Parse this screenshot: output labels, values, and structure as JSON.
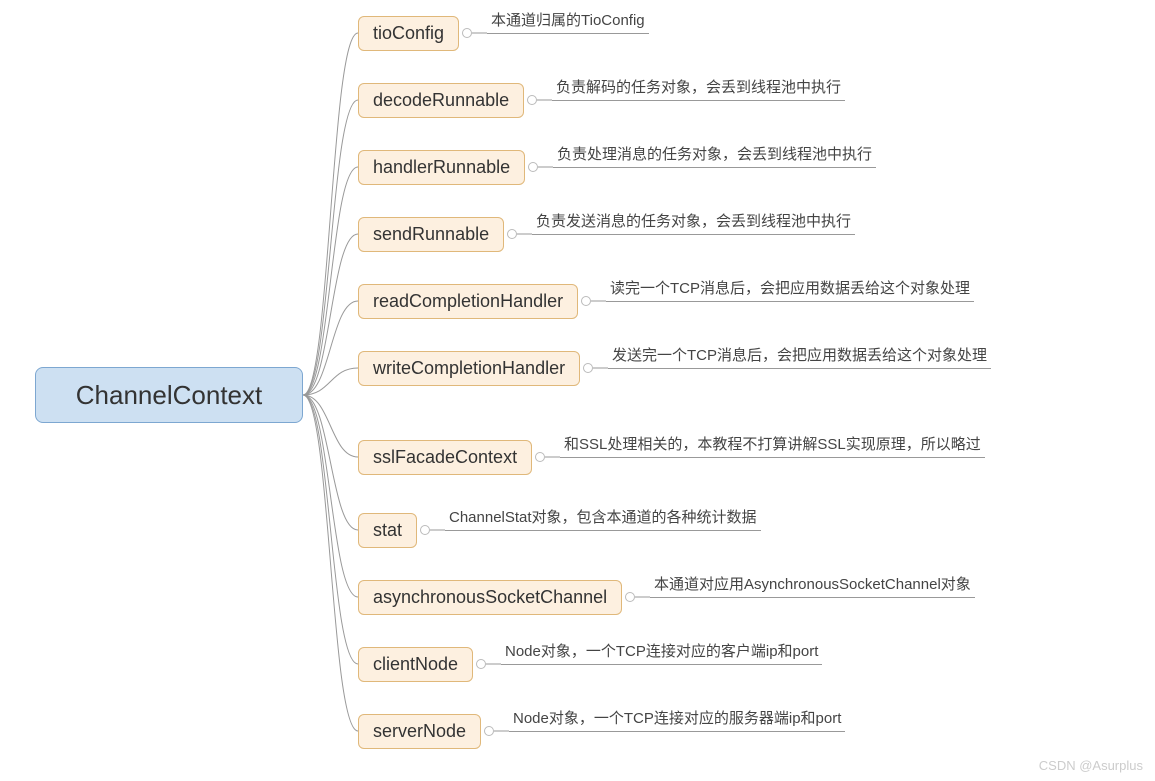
{
  "root": {
    "label": "ChannelContext"
  },
  "children": [
    {
      "label": "tioConfig",
      "desc": "本通道归属的TioConfig"
    },
    {
      "label": "decodeRunnable",
      "desc": "负责解码的任务对象，会丢到线程池中执行"
    },
    {
      "label": "handlerRunnable",
      "desc": "负责处理消息的任务对象，会丢到线程池中执行"
    },
    {
      "label": "sendRunnable",
      "desc": "负责发送消息的任务对象，会丢到线程池中执行"
    },
    {
      "label": "readCompletionHandler",
      "desc": "读完一个TCP消息后，会把应用数据丢给这个对象处理"
    },
    {
      "label": "writeCompletionHandler",
      "desc": "发送完一个TCP消息后，会把应用数据丢给这个对象处理"
    },
    {
      "label": "sslFacadeContext",
      "desc": "和SSL处理相关的，本教程不打算讲解SSL实现原理，所以略过"
    },
    {
      "label": "stat",
      "desc": "ChannelStat对象，包含本通道的各种统计数据"
    },
    {
      "label": "asynchronousSocketChannel",
      "desc": "本通道对应用AsynchronousSocketChannel对象"
    },
    {
      "label": "clientNode",
      "desc": "Node对象，一个TCP连接对应的客户端ip和port"
    },
    {
      "label": "serverNode",
      "desc": "Node对象，一个TCP连接对应的服务器端ip和port"
    }
  ],
  "watermark": "CSDN @Asurplus",
  "layout": {
    "rootRight": 303,
    "rootCenterY": 395,
    "childLeft": 358,
    "childYs": [
      33,
      100,
      167,
      234,
      301,
      368,
      457,
      530,
      597,
      664,
      731
    ],
    "leafLineEnd": 1105,
    "descMaxWidth": 480
  }
}
